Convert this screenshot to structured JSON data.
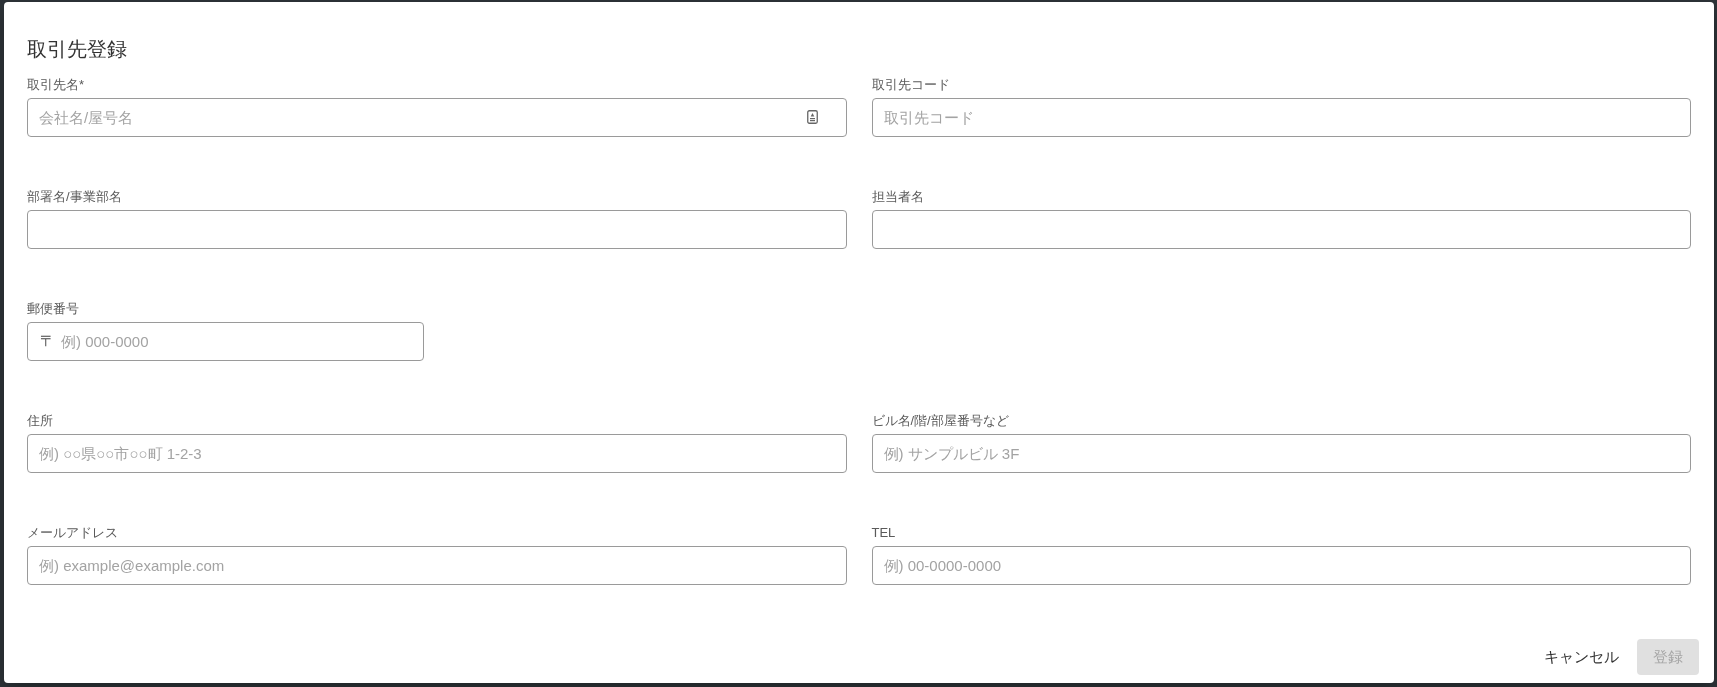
{
  "dialog": {
    "title": "取引先登録",
    "rows": [
      [
        {
          "label": "取引先名*",
          "kind": "icon",
          "placeholder": "会社名/屋号名"
        },
        {
          "label": "取引先コード",
          "kind": "text",
          "placeholder": "取引先コード"
        }
      ],
      [
        {
          "label": "部署名/事業部名",
          "kind": "text"
        },
        {
          "label": "担当者名",
          "kind": "text"
        }
      ],
      [
        {
          "label": "郵便番号",
          "kind": "prefixed",
          "prefix": "〒",
          "placeholder": "例) 000-0000"
        }
      ],
      [
        {
          "label": "住所",
          "kind": "text",
          "placeholder": "例) ○○県○○市○○町 1-2-3"
        },
        {
          "label": "ビル名/階/部屋番号など",
          "kind": "text",
          "placeholder": "例) サンプルビル 3F"
        }
      ],
      [
        {
          "label": "メールアドレス",
          "kind": "text",
          "placeholder": "例) example@example.com"
        },
        {
          "label": "TEL",
          "kind": "text",
          "placeholder": "例) 00-0000-0000"
        }
      ]
    ],
    "buttons": [
      {
        "label": "キャンセル",
        "kind": "text",
        "disabled": false
      },
      {
        "label": "登録",
        "kind": "contained",
        "disabled": true
      }
    ]
  }
}
